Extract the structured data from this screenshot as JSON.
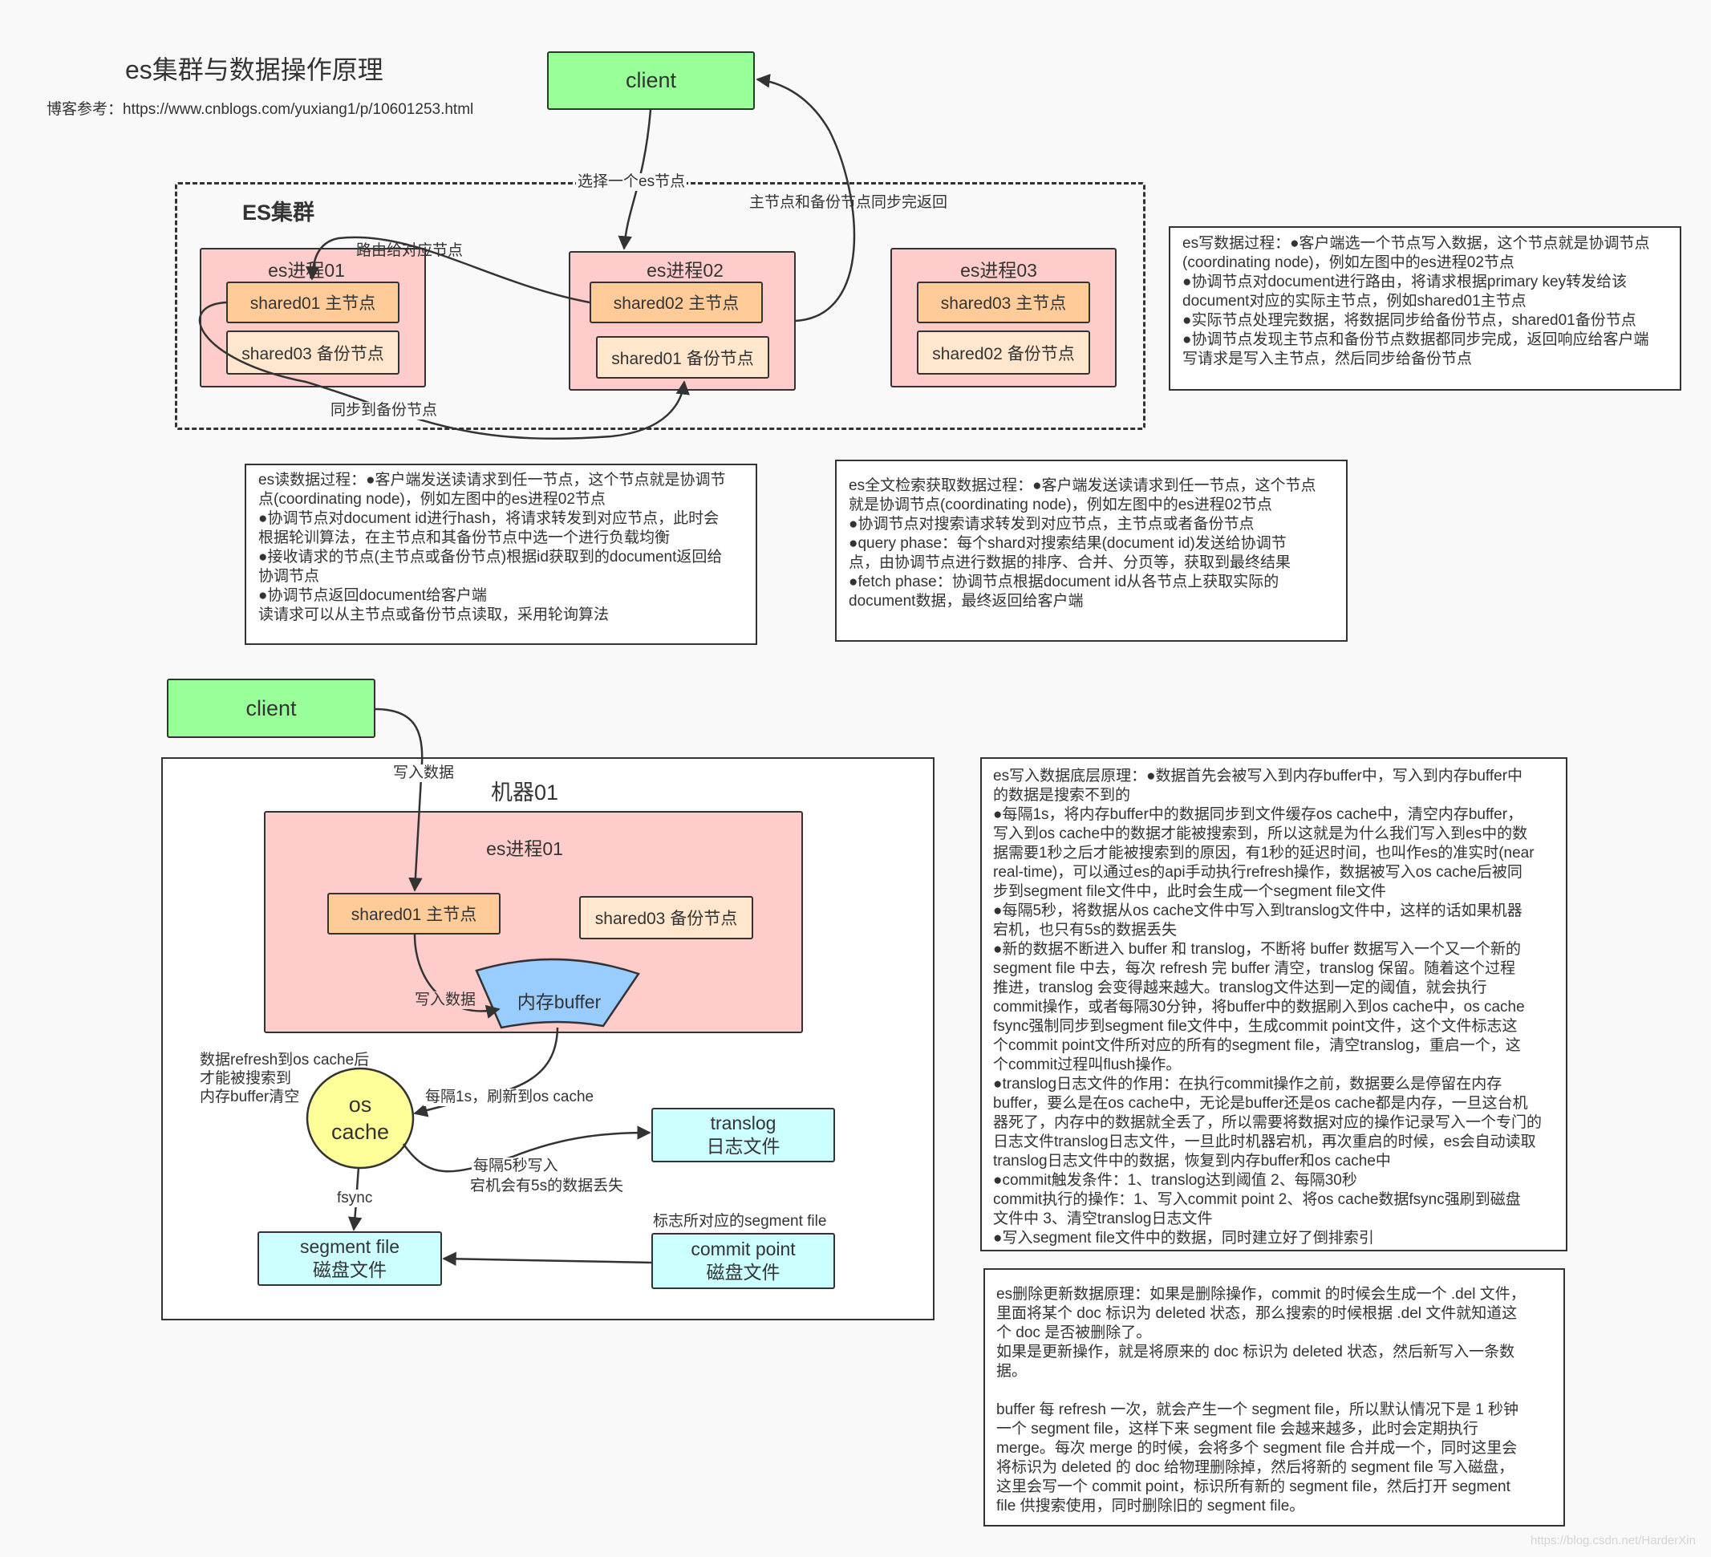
{
  "title": "es集群与数据操作原理",
  "reference": "博客参考：https://www.cnblogs.com/yuxiang1/p/10601253.html",
  "colors": {
    "background": "#f9f9f9",
    "client": "#99ff99",
    "process": "#ffcccc",
    "primary_shard": "#ffcc99",
    "replica_shard": "#ffe6cc",
    "buffer": "#99ccff",
    "os_cache": "#ffff99",
    "file": "#ccffff"
  },
  "cluster": {
    "client": "client",
    "label": "ES集群",
    "edge_labels": {
      "select_node": "选择一个es节点",
      "sync_return": "主节点和备份节点同步完返回",
      "route": "路由给对应节点",
      "sync_replica": "同步到备份节点"
    },
    "processes": [
      {
        "name": "es进程01",
        "primary": "shared01 主节点",
        "replica": "shared03 备份节点"
      },
      {
        "name": "es进程02",
        "primary": "shared02 主节点",
        "replica": "shared01 备份节点"
      },
      {
        "name": "es进程03",
        "primary": "shared03 主节点",
        "replica": "shared02 备份节点"
      }
    ]
  },
  "notes": {
    "write": {
      "lines": [
        "es写数据过程：●客户端选一个节点写入数据，这个节点就是协调节点",
        "(coordinating node)，例如左图中的es进程02节点",
        "●协调节点对document进行路由，将请求根据primary key转发给该",
        "document对应的实际主节点，例如shared01主节点",
        "●实际节点处理完数据，将数据同步给备份节点，shared01备份节点",
        "●协调节点发现主节点和备份节点数据都同步完成，返回响应给客户端",
        "写请求是写入主节点，然后同步给备份节点"
      ]
    },
    "read": {
      "lines": [
        "es读数据过程：●客户端发送读请求到任一节点，这个节点就是协调节",
        "点(coordinating node)，例如左图中的es进程02节点",
        "●协调节点对document id进行hash，将请求转发到对应节点，此时会",
        "根据轮训算法，在主节点和其备份节点中选一个进行负载均衡",
        "●接收请求的节点(主节点或备份节点)根据id获取到的document返回给",
        "协调节点",
        "●协调节点返回document给客户端",
        "读请求可以从主节点或备份节点读取，采用轮询算法"
      ]
    },
    "search": {
      "lines": [
        "es全文检索获取数据过程：●客户端发送读请求到任一节点，这个节点",
        "就是协调节点(coordinating node)，例如左图中的es进程02节点",
        "●协调节点对搜索请求转发到对应节点，主节点或者备份节点",
        "●query phase：每个shard对搜索结果(document id)发送给协调节",
        "点，由协调节点进行数据的排序、合并、分页等，获取到最终结果",
        "●fetch phase：协调节点根据document id从各节点上获取实际的",
        "document数据，最终返回给客户端"
      ]
    },
    "low_level_write": {
      "lines": [
        "es写入数据底层原理：●数据首先会被写入到内存buffer中，写入到内存buffer中",
        "的数据是搜索不到的",
        "●每隔1s，将内存buffer中的数据同步到文件缓存os cache中，清空内存buffer，",
        "写入到os cache中的数据才能被搜索到，所以这就是为什么我们写入到es中的数",
        "据需要1秒之后才能被搜索到的原因，有1秒的延迟时间，也叫作es的准实时(near",
        "real-time)，可以通过es的api手动执行refresh操作，数据被写入os cache后被同",
        "步到segment file文件中，此时会生成一个segment file文件",
        "●每隔5秒，将数据从os cache文件中写入到translog文件中，这样的话如果机器",
        "宕机，也只有5s的数据丢失",
        "●新的数据不断进入 buffer 和 translog，不断将 buffer 数据写入一个又一个新的",
        "segment file 中去，每次 refresh 完 buffer 清空，translog 保留。随着这个过程",
        "推进，translog 会变得越来越大。translog文件达到一定的阈值，就会执行",
        "commit操作，或者每隔30分钟，将buffer中的数据刷入到os cache中，os cache",
        "fsync强制同步到segment file文件中，生成commit point文件，这个文件标志这",
        "个commit point文件所对应的所有的segment file，清空translog，重启一个，这",
        "个commit过程叫flush操作。",
        "●translog日志文件的作用：在执行commit操作之前，数据要么是停留在内存",
        "buffer，要么是在os cache中，无论是buffer还是os cache都是内存，一旦这台机",
        "器死了，内存中的数据就全丢了，所以需要将数据对应的操作记录写入一个专门的",
        "日志文件translog日志文件，一旦此时机器宕机，再次重启的时候，es会自动读取",
        "translog日志文件中的数据，恢复到内存buffer和os cache中",
        "●commit触发条件：1、translog达到阈值  2、每隔30秒",
        "commit执行的操作：1、写入commit point  2、将os cache数据fsync强刷到磁盘",
        "文件中  3、清空translog日志文件",
        "●写入segment file文件中的数据，同时建立好了倒排索引"
      ]
    },
    "delete_update": {
      "lines": [
        "es删除更新数据原理：如果是删除操作，commit 的时候会生成一个 .del 文件，",
        "里面将某个 doc 标识为 deleted 状态，那么搜索的时候根据 .del 文件就知道这",
        "个 doc 是否被删除了。",
        "如果是更新操作，就是将原来的 doc 标识为 deleted 状态，然后新写入一条数",
        "据。",
        "",
        "buffer 每 refresh 一次，就会产生一个 segment file，所以默认情况下是 1 秒钟",
        "一个 segment file，这样下来 segment file 会越来越多，此时会定期执行",
        "merge。每次 merge 的时候，会将多个 segment file 合并成一个，同时这里会",
        "将标识为 deleted 的 doc 给物理删除掉，然后将新的 segment file 写入磁盘，",
        "这里会写一个 commit point，标识所有新的 segment file，然后打开 segment",
        "file 供搜索使用，同时删除旧的 segment file。"
      ]
    }
  },
  "machine": {
    "client": "client",
    "label": "机器01",
    "process": "es进程01",
    "primary": "shared01 主节点",
    "replica": "shared03 备份节点",
    "buffer": "内存buffer",
    "os_cache_line1": "os",
    "os_cache_line2": "cache",
    "translog_line1": "translog",
    "translog_line2": "日志文件",
    "segment_line1": "segment file",
    "segment_line2": "磁盘文件",
    "commit_line1": "commit point",
    "commit_line2": "磁盘文件",
    "edge_labels": {
      "client_write": "写入数据",
      "buffer_write": "写入数据",
      "refresh_note": [
        "数据refresh到os cache后",
        "才能被搜索到",
        "内存buffer清空"
      ],
      "refresh_1s": "每隔1s，刷新到os cache",
      "translog_5s": "每隔5秒写入",
      "translog_loss": "宕机会有5s的数据丢失",
      "fsync": "fsync",
      "commit_marks": "标志所对应的segment file"
    }
  },
  "watermark": "https://blog.csdn.net/HarderXin"
}
